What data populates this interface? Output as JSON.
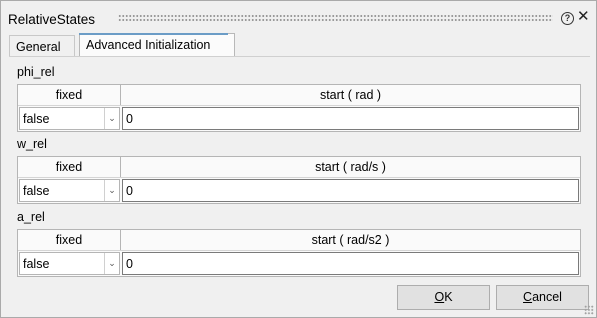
{
  "window": {
    "title": "RelativeStates",
    "help_symbol": "?",
    "close_symbol": "✕"
  },
  "tabs": [
    {
      "label": "General",
      "active": false
    },
    {
      "label": "Advanced Initialization",
      "active": true
    }
  ],
  "groups": [
    {
      "label": "phi_rel",
      "col_fixed": "fixed",
      "col_start": "start ( rad )",
      "fixed_value": "false",
      "start_value": "0"
    },
    {
      "label": "w_rel",
      "col_fixed": "fixed",
      "col_start": "start ( rad/s )",
      "fixed_value": "false",
      "start_value": "0"
    },
    {
      "label": "a_rel",
      "col_fixed": "fixed",
      "col_start": "start ( rad/s2 )",
      "fixed_value": "false",
      "start_value": "0"
    }
  ],
  "buttons": {
    "ok_mnemonic": "O",
    "ok_rest": "K",
    "cancel_mnemonic": "C",
    "cancel_rest": "ancel"
  },
  "icons": {
    "dropdown": "chevron-down-icon"
  }
}
